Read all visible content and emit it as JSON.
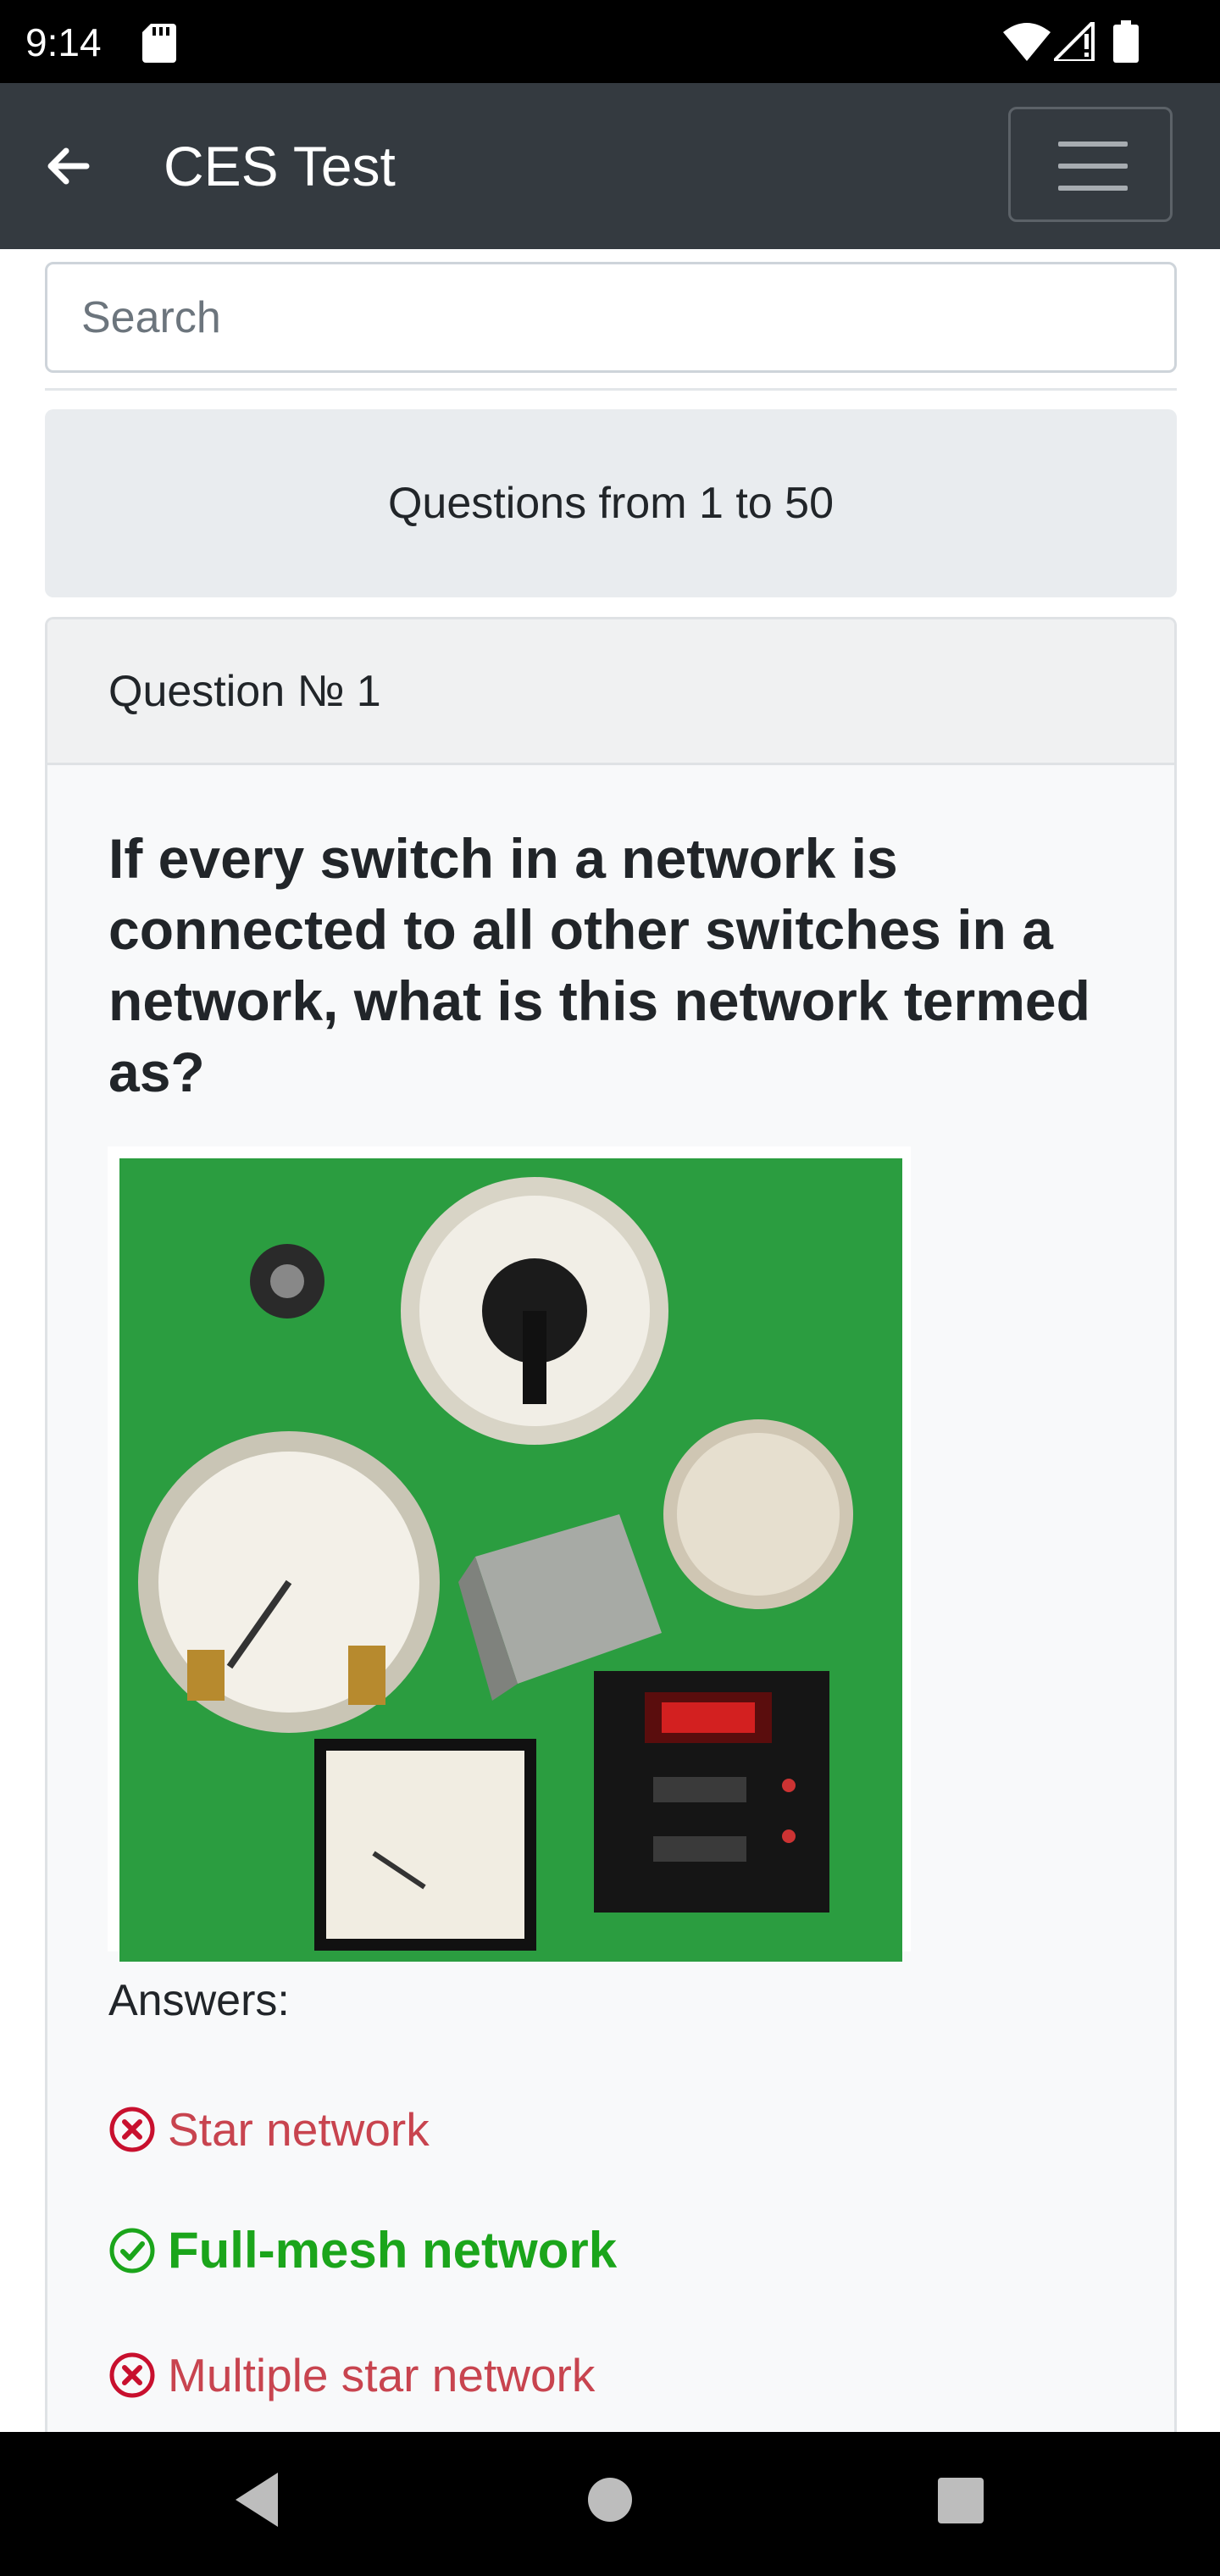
{
  "status_bar": {
    "time": "9:14"
  },
  "app_bar": {
    "title": "CES Test"
  },
  "search": {
    "placeholder": "Search"
  },
  "range_banner": {
    "text": "Questions from 1 to 50"
  },
  "question": {
    "header": "Question № 1",
    "text": "If every switch in a network is connected to all other switches in a network, what is this network termed as?",
    "answers_label": "Answers:",
    "answers": [
      {
        "text": "Star network",
        "correct": false
      },
      {
        "text": "Full-mesh network",
        "correct": true
      },
      {
        "text": "Multiple star network",
        "correct": false
      }
    ]
  },
  "colors": {
    "app_bar": "#343a40",
    "correct": "#1ba51b",
    "wrong": "#c8444f",
    "photo_background": "#2fa845"
  }
}
